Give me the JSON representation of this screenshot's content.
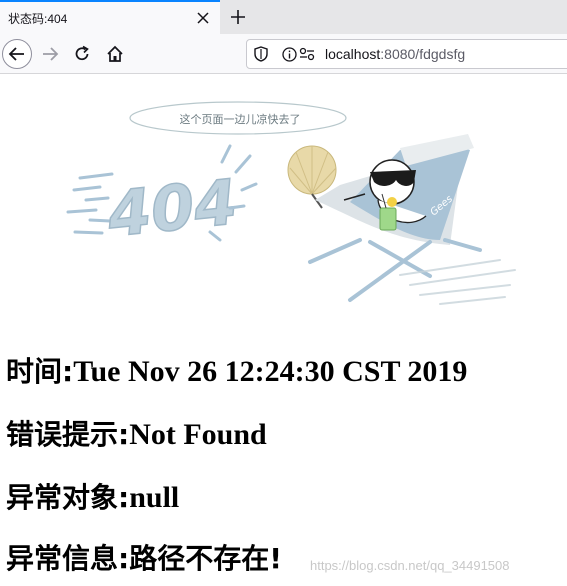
{
  "browser": {
    "tab": {
      "title": "状态码:404"
    },
    "url": {
      "host": "localhost",
      "rest": ":8080/fdgdsfg"
    }
  },
  "illustration": {
    "bubble_text": "这个页面一边儿凉快去了",
    "big_text": "404",
    "chair_text": "Gees"
  },
  "error": {
    "time_label": "时间:",
    "time_value": "Tue Nov 26 12:24:30 CST 2019",
    "message_label": "错误提示:",
    "message_value": "Not Found",
    "exception_label": "异常对象:",
    "exception_value": "null",
    "info_label": "异常信息:",
    "info_value": "路径不存在!"
  },
  "watermark": "https://blog.csdn.net/qq_34491508",
  "colors": {
    "tab_accent": "#0a84ff",
    "illus_blue": "#a9c3d6"
  }
}
